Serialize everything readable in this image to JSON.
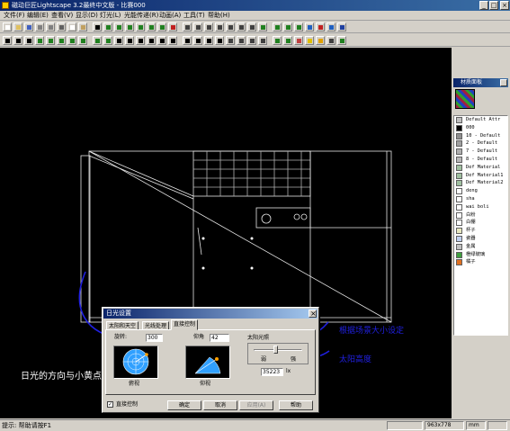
{
  "window": {
    "title": "磁动巨匠Lightscape 3.2最终中文版 - 比赛000",
    "minimize": "_",
    "maximize": "□",
    "close": "×"
  },
  "menu": [
    {
      "label": "文件(F)"
    },
    {
      "label": "编辑(E)"
    },
    {
      "label": "查看(V)"
    },
    {
      "label": "显示(D)"
    },
    {
      "label": "灯光(L)"
    },
    {
      "label": "光能传递(R)"
    },
    {
      "label": "动画(A)"
    },
    {
      "label": "工具(T)"
    },
    {
      "label": "帮助(H)"
    }
  ],
  "toolbar_row1": [
    {
      "icon": "new-file-icon",
      "color": "#ffffff"
    },
    {
      "icon": "open-file-icon",
      "color": "#e0c060"
    },
    {
      "icon": "save-icon",
      "color": "#4060c0"
    },
    {
      "icon": "print-icon",
      "color": "#808080"
    },
    {
      "icon": "print-preview-icon",
      "color": "#808080"
    },
    {
      "icon": "cut-icon",
      "color": "#606060"
    },
    {
      "icon": "copy-icon",
      "color": "#ffffff"
    },
    {
      "icon": "paste-icon",
      "color": "#c0a060"
    },
    {
      "icon": "select-icon",
      "color": "#000000"
    },
    {
      "icon": "surface-icon",
      "color": "#208020"
    },
    {
      "icon": "block-icon",
      "color": "#208020"
    },
    {
      "icon": "light-icon",
      "color": "#208020"
    },
    {
      "icon": "window-icon",
      "color": "#208020"
    },
    {
      "icon": "material-icon",
      "color": "#208020"
    },
    {
      "icon": "layer-icon",
      "color": "#208020"
    },
    {
      "icon": "view-icon",
      "color": "#c02020"
    },
    {
      "icon": "zoom-in-icon",
      "color": "#404040"
    },
    {
      "icon": "zoom-out-icon",
      "color": "#404040"
    },
    {
      "icon": "zoom-window-icon",
      "color": "#404040"
    },
    {
      "icon": "pan-icon",
      "color": "#404040"
    },
    {
      "icon": "orbit-icon",
      "color": "#404040"
    },
    {
      "icon": "zoom-extents-icon",
      "color": "#404040"
    },
    {
      "icon": "previous-view-icon",
      "color": "#404040"
    },
    {
      "icon": "render-wire-icon",
      "color": "#208020"
    },
    {
      "icon": "render-solid-icon",
      "color": "#208020"
    },
    {
      "icon": "render-texture-icon",
      "color": "#208020"
    },
    {
      "icon": "render-light-icon",
      "color": "#208020"
    },
    {
      "icon": "process-start-icon",
      "color": "#2060c0"
    },
    {
      "icon": "process-stop-icon",
      "color": "#c02020"
    },
    {
      "icon": "process-reset-icon",
      "color": "#2060c0"
    },
    {
      "icon": "help-icon",
      "color": "#2040a0"
    }
  ],
  "toolbar_row2": [
    {
      "icon": "arrow-icon",
      "color": "#000000"
    },
    {
      "icon": "hand-icon",
      "color": "#000000"
    },
    {
      "icon": "select-face-icon",
      "color": "#000000"
    },
    {
      "icon": "select-all-icon",
      "color": "#208020"
    },
    {
      "icon": "deselect-icon",
      "color": "#208020"
    },
    {
      "icon": "invert-icon",
      "color": "#208020"
    },
    {
      "icon": "select-light-icon",
      "color": "#208020"
    },
    {
      "icon": "select-block-icon",
      "color": "#208020"
    },
    {
      "icon": "select-window-icon",
      "color": "#208020"
    },
    {
      "icon": "select-crossing-icon",
      "color": "#208020"
    },
    {
      "icon": "move-icon",
      "color": "#000000"
    },
    {
      "icon": "rotate-icon",
      "color": "#000000"
    },
    {
      "icon": "scale-icon",
      "color": "#000000"
    },
    {
      "icon": "mirror-icon",
      "color": "#000000"
    },
    {
      "icon": "axis-x-icon",
      "color": "#000000"
    },
    {
      "icon": "axis-y-icon",
      "color": "#000000"
    },
    {
      "icon": "axis-z-icon",
      "color": "#000000"
    },
    {
      "icon": "plane-xy-icon",
      "color": "#000000"
    },
    {
      "icon": "plane-yz-icon",
      "color": "#000000"
    },
    {
      "icon": "plane-zx-icon",
      "color": "#000000"
    },
    {
      "icon": "snap-icon",
      "color": "#404040"
    },
    {
      "icon": "camera-icon",
      "color": "#404040"
    },
    {
      "icon": "walk-icon",
      "color": "#404040"
    },
    {
      "icon": "teapot-icon",
      "color": "#404040"
    },
    {
      "icon": "material-edit-icon",
      "color": "#208020"
    },
    {
      "icon": "sphere-icon",
      "color": "#208020"
    },
    {
      "icon": "texture-map-icon",
      "color": "#c04040"
    },
    {
      "icon": "light-bulb-icon",
      "color": "#e0c000"
    },
    {
      "icon": "daylight-icon",
      "color": "#e0a000"
    },
    {
      "icon": "figure-icon",
      "color": "#404040"
    },
    {
      "icon": "tree-icon",
      "color": "#208020"
    }
  ],
  "status": {
    "left": "提示: 帮助请按F1",
    "size": "963x778",
    "unit": "mm"
  },
  "material_panel": {
    "title": "材质面板",
    "items": [
      {
        "name": "Default Attr",
        "color": "#c0c0c0"
      },
      {
        "name": "000",
        "color": "#000000"
      },
      {
        "name": "10 - Default",
        "color": "#909090"
      },
      {
        "name": "2 - Default",
        "color": "#a0a0a0"
      },
      {
        "name": "7 - Default",
        "color": "#b0b0b0"
      },
      {
        "name": "8 - Default",
        "color": "#b8b8b8"
      },
      {
        "name": "Def Material",
        "color": "#a0c0a0"
      },
      {
        "name": "Def Material1",
        "color": "#a0c0a0"
      },
      {
        "name": "Def Material2",
        "color": "#a0c0a0"
      },
      {
        "name": "deng",
        "color": "#ffffff"
      },
      {
        "name": "sha",
        "color": "#ffffff"
      },
      {
        "name": "wai boli",
        "color": "#ffffff"
      },
      {
        "name": "白粉",
        "color": "#ffffff"
      },
      {
        "name": "白棚",
        "color": "#ffffff"
      },
      {
        "name": "杯子",
        "color": "#e8e8c0"
      },
      {
        "name": "瓷器",
        "color": "#c0d0f0"
      },
      {
        "name": "金属",
        "color": "#c0c0c0"
      },
      {
        "name": "橙绿玻璃",
        "color": "#40a040"
      },
      {
        "name": "橘子",
        "color": "#e07020"
      }
    ]
  },
  "dialog": {
    "title": "日光设置",
    "tabs": [
      "太阳和天空",
      "光线处理",
      "直接控制"
    ],
    "selected_tab": 2,
    "rotation_label": "旋转:",
    "rotation_value": "300",
    "elevation_label": "仰角",
    "elevation_value": "42",
    "plan_view_label": "俯视",
    "elevation_view_label": "仰视",
    "sun_intensity_label": "太阳光照",
    "bright_label": "弱",
    "dark_label": "强",
    "sun_intensity": 0.45,
    "lux_value": "35223",
    "lux_unit": "lx",
    "direct_control_label": "直接控制",
    "direct_control_checked": true,
    "buttons": [
      "确定",
      "取消",
      "应用(A)",
      "帮助"
    ]
  },
  "annotations": {
    "scene_size": "根据场景大小设定",
    "sun_height": "太阳高度",
    "direction_note": "日光的方向与小黄点相对应"
  },
  "colors": {
    "title_blue": "#0a246a",
    "annotation_blue": "#2020e0",
    "sun_dot": "#ffa000",
    "viewport_bg": "#000000",
    "compass_blue": "#30a0ff"
  }
}
